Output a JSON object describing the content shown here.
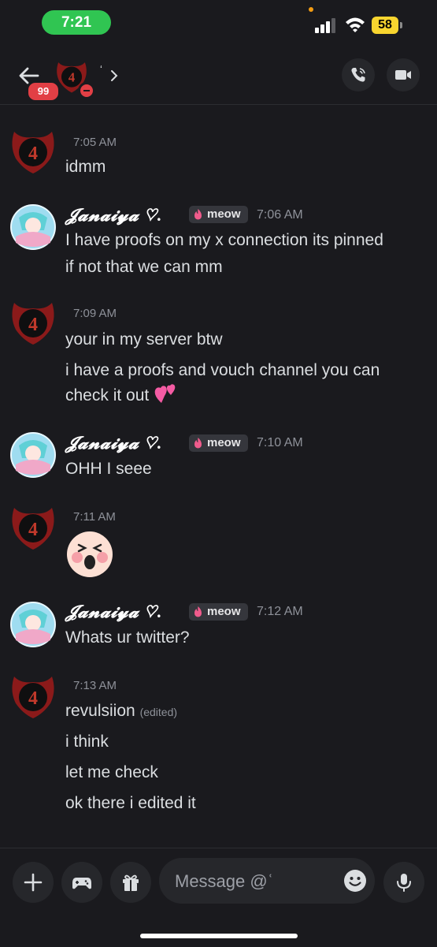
{
  "status_bar": {
    "time": "7:21",
    "battery": "58"
  },
  "header": {
    "unread_count": "99",
    "channel_name": "‘"
  },
  "composer": {
    "placeholder": "Message @ʿ"
  },
  "messages": [
    {
      "author": "",
      "time": "7:05 AM",
      "lines": [
        "idmm"
      ]
    },
    {
      "author": "𝓙𝓪𝓷𝓪𝓲𝔂𝓪 ♡.",
      "tag": "meow",
      "time": "7:06 AM",
      "lines": [
        "I have proofs on my x connection its pinned",
        "if not that we can mm"
      ]
    },
    {
      "author": "",
      "time": "7:09 AM",
      "lines": [
        "your in my server btw",
        "i have a proofs and vouch channel you can",
        "check it out"
      ]
    },
    {
      "author": "𝓙𝓪𝓷𝓪𝓲𝔂𝓪 ♡.",
      "tag": "meow",
      "time": "7:10 AM",
      "lines": [
        "OHH I seee"
      ]
    },
    {
      "author": "",
      "time": "7:11 AM",
      "lines": []
    },
    {
      "author": "𝓙𝓪𝓷𝓪𝓲𝔂𝓪 ♡.",
      "tag": "meow",
      "time": "7:12 AM",
      "lines": [
        "Whats ur twitter?"
      ]
    },
    {
      "author": "",
      "time": "7:13 AM",
      "lines": [
        "revulsiion",
        "i think",
        "let me check",
        "ok there i edited it"
      ],
      "edited_label": "(edited)"
    }
  ],
  "colors": {
    "status_green": "#30c552",
    "battery_yellow": "#f8d52f",
    "badge_red": "#e23f45",
    "background": "#1a1a1e"
  },
  "icons": [
    "back-arrow-icon",
    "call-icon",
    "video-icon",
    "plus-icon",
    "gamepad-icon",
    "gift-icon",
    "smiley-icon",
    "microphone-icon"
  ]
}
